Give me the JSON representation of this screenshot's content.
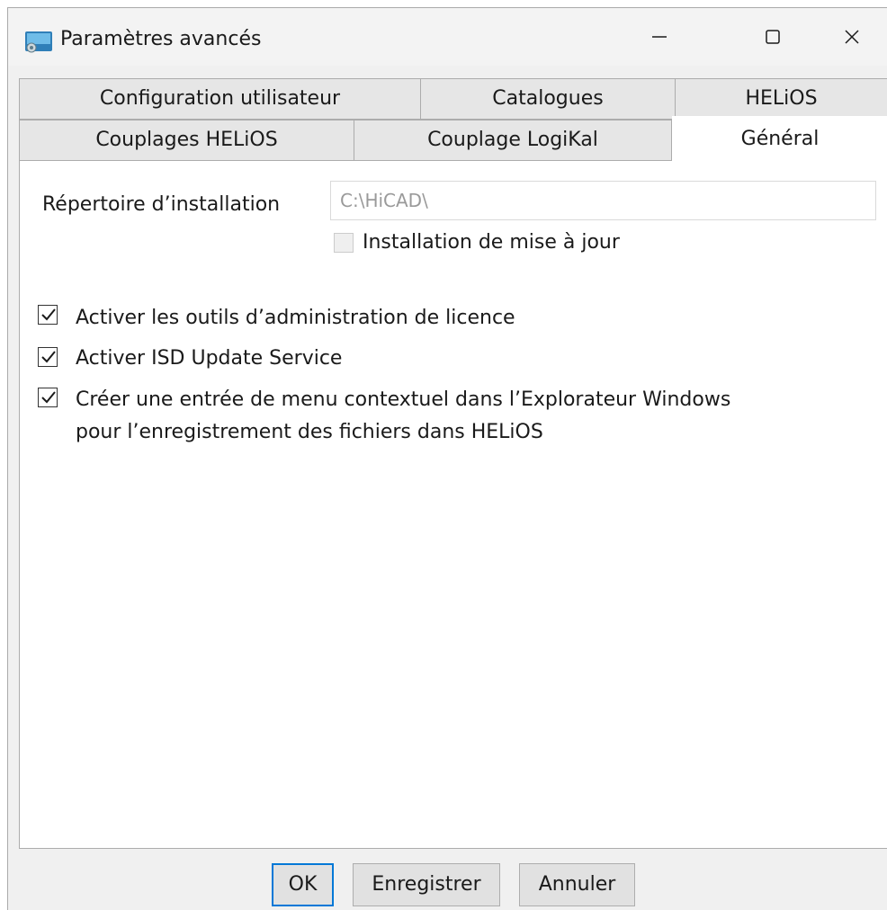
{
  "window": {
    "title": "Paramètres avancés",
    "controls": {
      "minimize": "minimize",
      "maximize": "maximize",
      "close": "close"
    }
  },
  "tabs": {
    "row1": [
      "Configuration utilisateur",
      "Catalogues",
      "HELiOS"
    ],
    "row2": [
      "Couplages HELiOS",
      "Couplage LogiKal",
      "Général"
    ],
    "active": "Général"
  },
  "general": {
    "install_dir_label": "Répertoire d’installation",
    "install_dir_value": "C:\\HiCAD\\",
    "update_install": {
      "label": "Installation de mise à jour",
      "checked": false,
      "enabled": false
    },
    "options": [
      {
        "label": "Activer les outils d’administration de licence",
        "checked": true
      },
      {
        "label": "Activer ISD Update Service",
        "checked": true
      },
      {
        "label_line1": "Créer une entrée de menu contextuel dans l’Explorateur Windows",
        "label_line2": "pour l’enregistrement des fichiers dans HELiOS",
        "checked": true
      }
    ]
  },
  "buttons": {
    "ok": "OK",
    "save": "Enregistrer",
    "cancel": "Annuler"
  },
  "colors": {
    "accent": "#0078d7",
    "panel": "#ffffff",
    "chrome": "#f0f0f0"
  }
}
